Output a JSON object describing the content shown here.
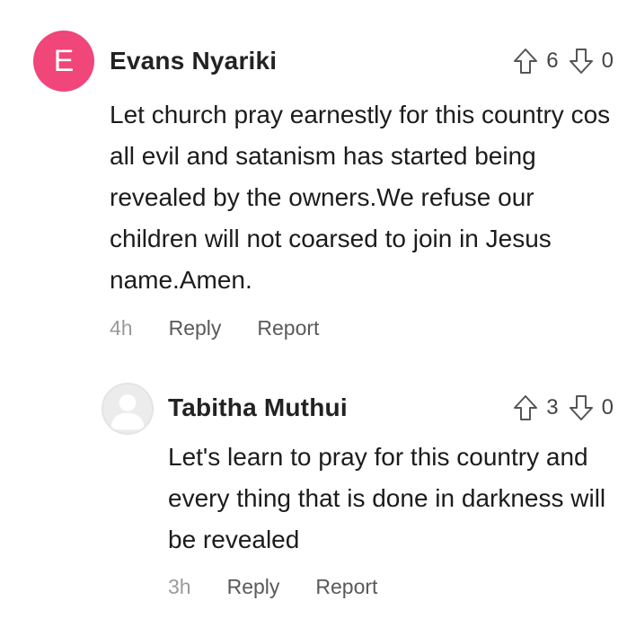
{
  "comments": [
    {
      "avatar_letter": "E",
      "avatar_color": "#f0467a",
      "author": "Evans Nyariki",
      "upvotes": "6",
      "downvotes": "0",
      "text": "Let church pray earnestly for this country cos all evil and satanism has started being revealed by the owners.We refuse our children will not coarsed to join in Jesus name.Amen.",
      "time": "4h",
      "reply_label": "Reply",
      "report_label": "Report"
    },
    {
      "avatar_icon": "default-user-icon",
      "author": "Tabitha Muthui",
      "upvotes": "3",
      "downvotes": "0",
      "text": "Let's learn to pray for this country and every thing that is done in darkness will be revealed",
      "time": "3h",
      "reply_label": "Reply",
      "report_label": "Report"
    }
  ],
  "icons": {
    "upvote": "arrow-up-outline-icon",
    "downvote": "arrow-down-outline-icon"
  }
}
